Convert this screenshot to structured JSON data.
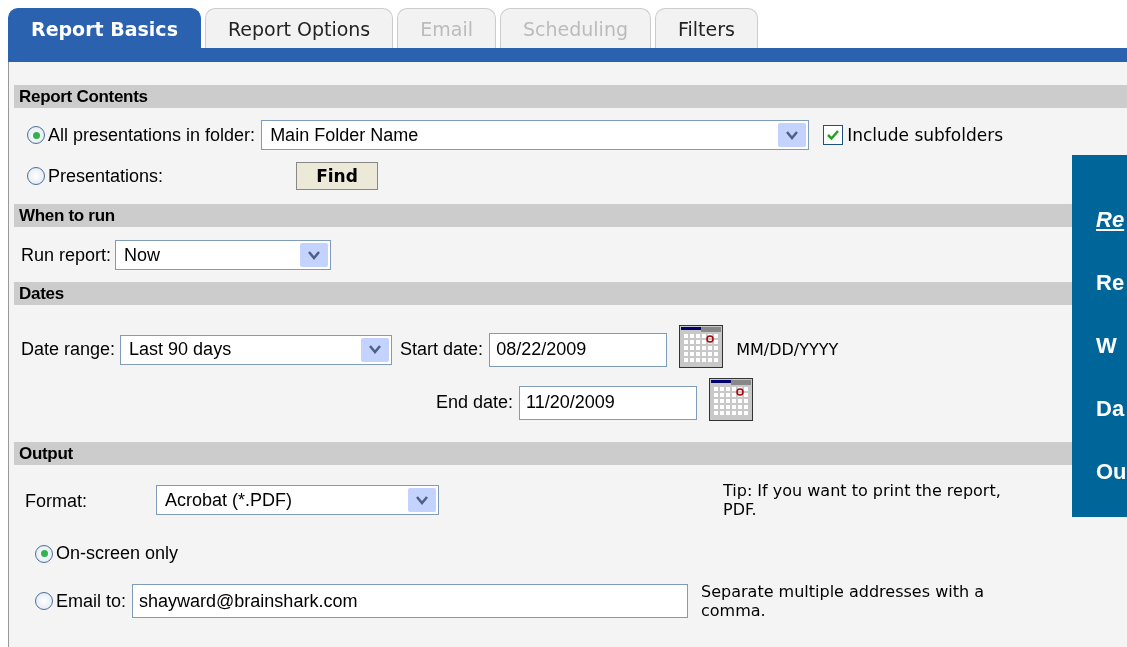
{
  "tabs": [
    {
      "label": "Report Basics",
      "selected": true,
      "disabled": false
    },
    {
      "label": "Report Options",
      "selected": false,
      "disabled": false
    },
    {
      "label": "Email",
      "selected": false,
      "disabled": true
    },
    {
      "label": "Scheduling",
      "selected": false,
      "disabled": true
    },
    {
      "label": "Filters",
      "selected": false,
      "disabled": false
    }
  ],
  "report_contents": {
    "heading": "Report Contents",
    "folder_option": {
      "label": "All presentations in folder:",
      "selected": true
    },
    "folder_select": {
      "value": "Main Folder Name"
    },
    "include_subfolders": {
      "label": "Include subfolders",
      "checked": true
    },
    "presentations_option": {
      "label": "Presentations:",
      "selected": false
    },
    "find_button": "Find"
  },
  "when_to_run": {
    "heading": "When to run",
    "label": "Run report:",
    "select": {
      "value": "Now"
    }
  },
  "dates": {
    "heading": "Dates",
    "range_label": "Date range:",
    "range_select": {
      "value": "Last 90 days"
    },
    "start_label": "Start date:",
    "start_value": "08/22/2009",
    "format_hint": "MM/DD/YYYY",
    "end_label": "End date:",
    "end_value": "11/20/2009"
  },
  "output": {
    "heading": "Output",
    "format_label": "Format:",
    "format_select": {
      "value": "Acrobat (*.PDF)"
    },
    "tip_lines": [
      "Tip: If you want to print the report,",
      "PDF."
    ],
    "onscreen_option": {
      "label": "On-screen only",
      "selected": true
    },
    "email_option": {
      "label": "Email to:",
      "selected": false
    },
    "email_value": "shayward@brainshark.com",
    "email_note_lines": [
      "Separate multiple addresses with a",
      "comma."
    ]
  },
  "side_panel": {
    "title": "Re",
    "items": [
      "Re",
      "W",
      "Da",
      "Ou"
    ]
  }
}
